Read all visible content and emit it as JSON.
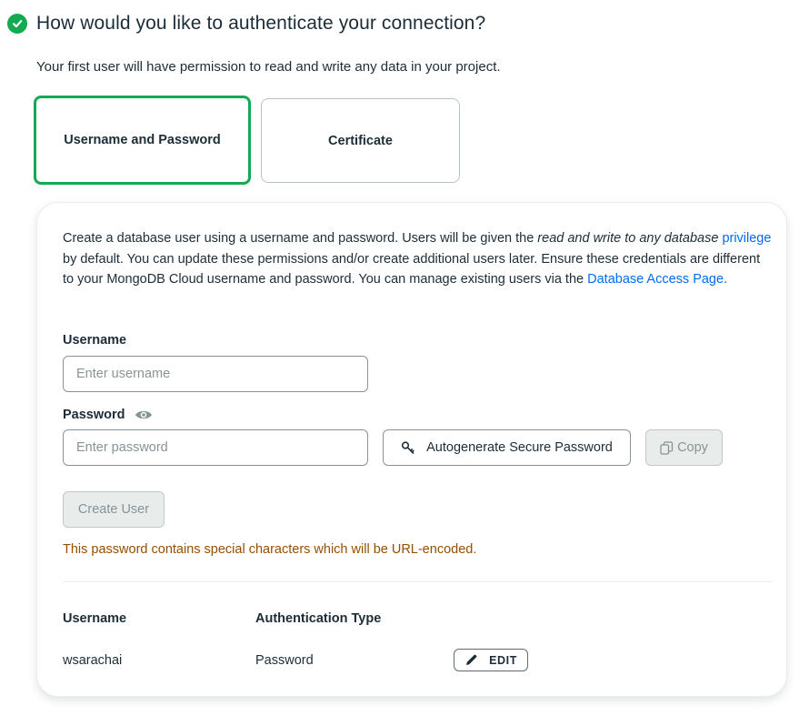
{
  "header": {
    "title": "How would you like to authenticate your connection?",
    "subtitle": "Your first user will have permission to read and write any data in your project."
  },
  "auth_options": [
    {
      "label": "Username and Password",
      "selected": true
    },
    {
      "label": "Certificate",
      "selected": false
    }
  ],
  "panel": {
    "desc_part1": "Create a database user using a username and password. Users will be given the ",
    "desc_italic": "read and write to any database",
    "desc_link1": "privilege",
    "desc_part2": " by default. You can update these permissions and/or create additional users later. Ensure these credentials are different to your MongoDB Cloud username and password. You can manage existing users via the ",
    "desc_link2": "Database Access Page.",
    "username_label": "Username",
    "username_placeholder": "Enter username",
    "password_label": "Password",
    "password_placeholder": "Enter password",
    "autogen_label": "Autogenerate Secure Password",
    "copy_label": "Copy",
    "create_label": "Create User",
    "warning": "This password contains special characters which will be URL-encoded."
  },
  "users_table": {
    "headers": [
      "Username",
      "Authentication Type"
    ],
    "rows": [
      {
        "username": "wsarachai",
        "auth_type": "Password",
        "action": "EDIT"
      }
    ]
  },
  "colors": {
    "accent_green": "#13aa52",
    "link_blue": "#016bf8",
    "warning_brown": "#944f01"
  },
  "icons": [
    "check-circle-icon",
    "eye-icon",
    "key-icon",
    "copy-icon",
    "pencil-icon"
  ]
}
